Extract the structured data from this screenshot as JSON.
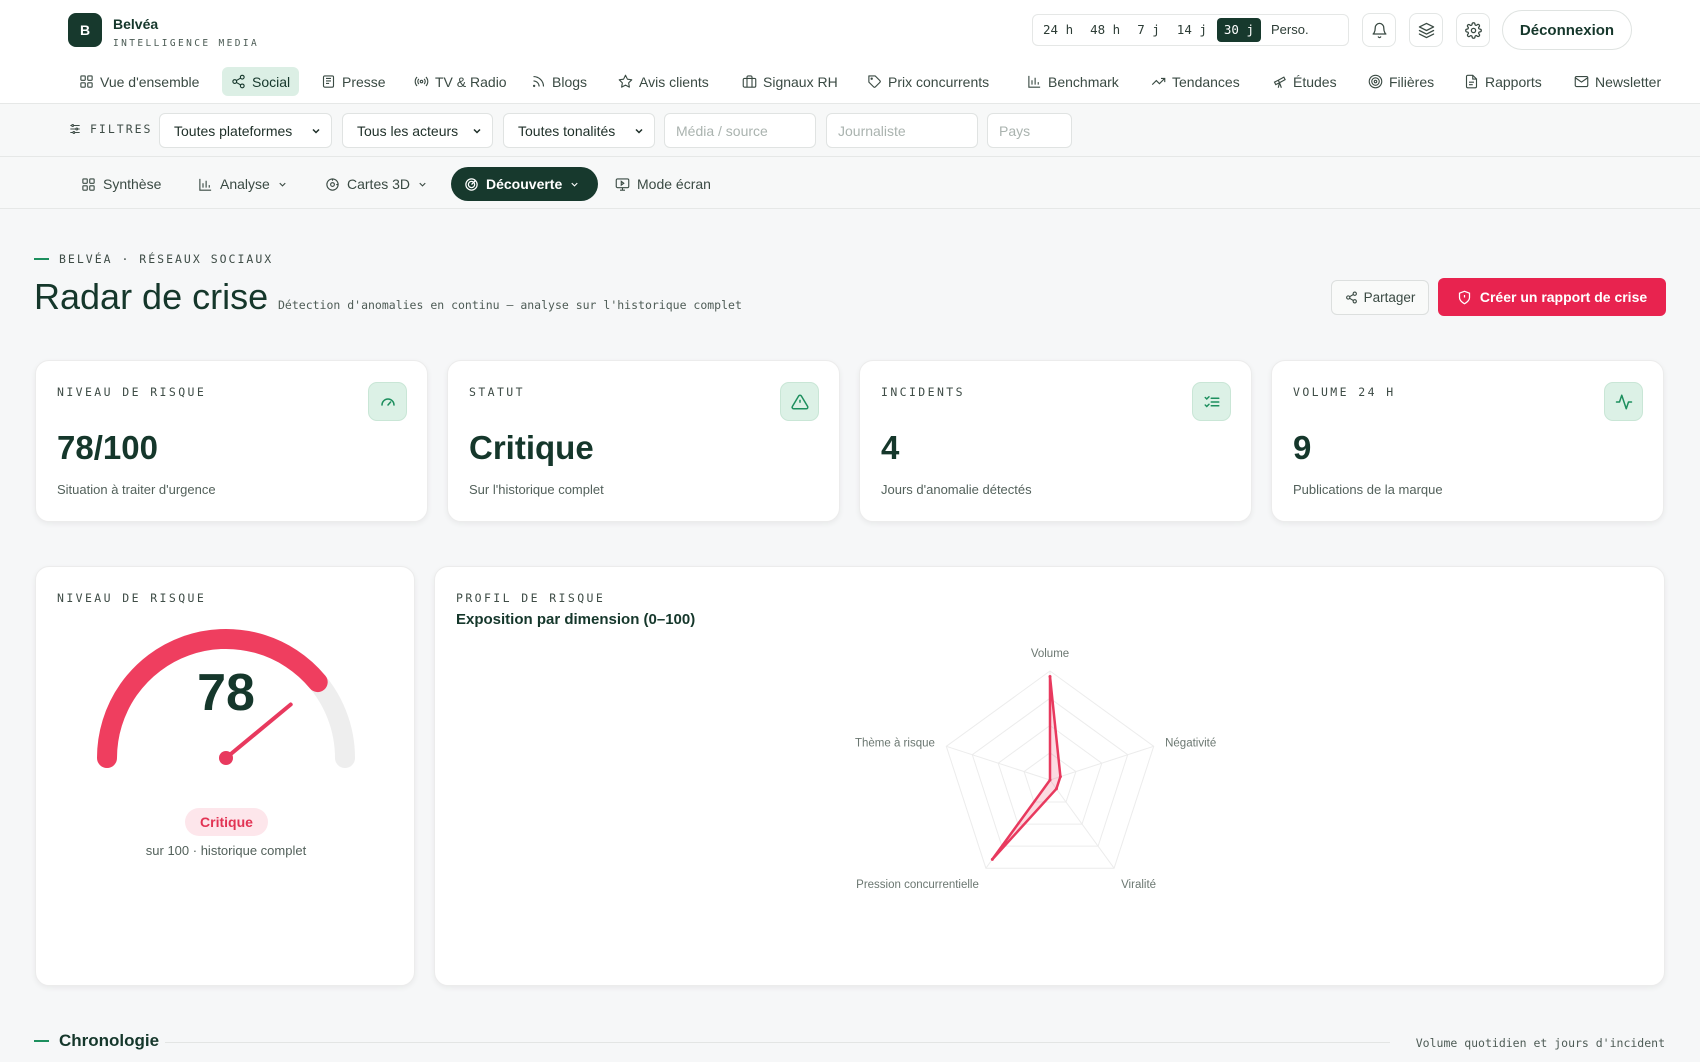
{
  "brand": {
    "name": "Belvéa",
    "subtitle": "INTELLIGENCE MEDIA",
    "logo_letter": "B"
  },
  "range": {
    "items": [
      "24 h",
      "48 h",
      "7 j",
      "14 j",
      "30 j",
      "Perso."
    ],
    "active": "30 j"
  },
  "header": {
    "logout_label": "Déconnexion",
    "icons": [
      "bell-icon",
      "layers-icon",
      "gear-icon"
    ]
  },
  "nav": {
    "items": [
      {
        "label": "Vue d'ensemble",
        "icon": "grid-icon"
      },
      {
        "label": "Social",
        "icon": "share-icon",
        "active": true
      },
      {
        "label": "Presse",
        "icon": "newspaper-icon"
      },
      {
        "label": "TV & Radio",
        "icon": "broadcast-icon"
      },
      {
        "label": "Blogs",
        "icon": "rss-icon"
      },
      {
        "label": "Avis clients",
        "icon": "star-icon"
      },
      {
        "label": "Signaux RH",
        "icon": "briefcase-icon"
      },
      {
        "label": "Prix concurrents",
        "icon": "tag-icon"
      },
      {
        "label": "Benchmark",
        "icon": "bar-chart-icon"
      },
      {
        "label": "Tendances",
        "icon": "trending-icon"
      },
      {
        "label": "Études",
        "icon": "telescope-icon"
      },
      {
        "label": "Filières",
        "icon": "target-icon"
      },
      {
        "label": "Rapports",
        "icon": "document-icon"
      },
      {
        "label": "Newsletter",
        "icon": "mail-icon"
      }
    ]
  },
  "filters": {
    "label": "FILTRES",
    "selects": [
      "Toutes plateformes",
      "Tous les acteurs",
      "Toutes tonalités"
    ],
    "inputs": [
      "Média / source",
      "Journaliste",
      "Pays"
    ]
  },
  "subnav": {
    "items": [
      {
        "label": "Synthèse",
        "icon": "grid-icon"
      },
      {
        "label": "Analyse",
        "icon": "bar-chart-icon",
        "dropdown": true
      },
      {
        "label": "Cartes 3D",
        "icon": "map-3d-icon",
        "dropdown": true
      },
      {
        "label": "Découverte",
        "icon": "radar-icon",
        "dropdown": true,
        "active": true
      },
      {
        "label": "Mode écran",
        "icon": "screen-play-icon"
      }
    ]
  },
  "page": {
    "eyebrow": "BELVÉA · RÉSEAUX SOCIAUX",
    "title": "Radar de crise",
    "description": "Détection d'anomalies en continu — analyse sur l'historique complet",
    "share_label": "Partager",
    "crisis_label": "Créer un rapport de crise"
  },
  "kpis": [
    {
      "label": "NIVEAU DE RISQUE",
      "value": "78/100",
      "sub": "Situation à traiter d'urgence",
      "icon": "gauge-icon"
    },
    {
      "label": "STATUT",
      "value": "Critique",
      "sub": "Sur l'historique complet",
      "icon": "alert-triangle-icon"
    },
    {
      "label": "INCIDENTS",
      "value": "4",
      "sub": "Jours d'anomalie détectés",
      "icon": "checklist-icon"
    },
    {
      "label": "VOLUME 24 H",
      "value": "9",
      "sub": "Publications de la marque",
      "icon": "activity-icon"
    }
  ],
  "gauge": {
    "label": "NIVEAU DE RISQUE",
    "value": "78",
    "max": 100,
    "fraction": 0.78,
    "badge": "Critique",
    "sub": "sur 100 · historique complet",
    "color": "#ef3e5f"
  },
  "radar": {
    "label": "PROFIL DE RISQUE",
    "title": "Exposition par dimension (0–100)"
  },
  "chart_data": {
    "type": "radar",
    "categories": [
      "Volume",
      "Négativité",
      "Viralité",
      "Pression concurrentielle",
      "Thème à risque"
    ],
    "values": [
      95,
      10,
      10,
      90,
      0
    ],
    "range": [
      0,
      100
    ],
    "color": "#e8395e"
  },
  "chronology": {
    "title": "Chronologie",
    "right": "Volume quotidien et jours d'incident"
  }
}
